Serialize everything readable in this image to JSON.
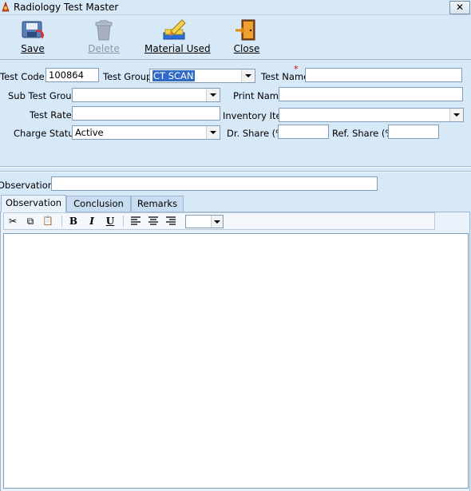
{
  "window": {
    "title": "Radiology Test Master",
    "close_glyph": "✕"
  },
  "toolbar": {
    "buttons": [
      {
        "label": "Save",
        "icon": "save-icon",
        "enabled": true
      },
      {
        "label": "Delete",
        "icon": "delete-icon",
        "enabled": false
      },
      {
        "label": "Material Used",
        "icon": "material-used-icon",
        "enabled": true
      },
      {
        "label": "Close",
        "icon": "close-door-icon",
        "enabled": true
      }
    ]
  },
  "form": {
    "test_code": {
      "label": "Test Code",
      "value": "100864"
    },
    "test_group": {
      "label": "Test Group",
      "value": "CT SCAN"
    },
    "test_name": {
      "label": "Test Name",
      "required_mark": "*",
      "value": ""
    },
    "sub_test_group": {
      "label": "Sub Test Group",
      "value": ""
    },
    "print_name": {
      "label": "Print Name",
      "value": ""
    },
    "test_rate": {
      "label": "Test Rate",
      "value": ""
    },
    "inventory_item": {
      "label": "Inventory Item",
      "value": ""
    },
    "charge_status": {
      "label": "Charge Status",
      "value": "Active"
    },
    "dr_share": {
      "label": "Dr. Share (%)",
      "value": ""
    },
    "ref_share": {
      "label": "Ref. Share (%)",
      "value": ""
    },
    "observations": {
      "label": "Observations",
      "value": ""
    }
  },
  "tabs": [
    {
      "label": "Observation",
      "active": true
    },
    {
      "label": "Conclusion",
      "active": false
    },
    {
      "label": "Remarks",
      "active": false
    }
  ],
  "editor_toolbar": {
    "cut": "✂",
    "copy": "⧉",
    "paste": "📋",
    "bold": "B",
    "italic": "I",
    "underline": "U",
    "font_size_value": ""
  },
  "colors": {
    "background": "#d7e8f7",
    "selection": "#3169c6",
    "required": "#cc0000"
  }
}
